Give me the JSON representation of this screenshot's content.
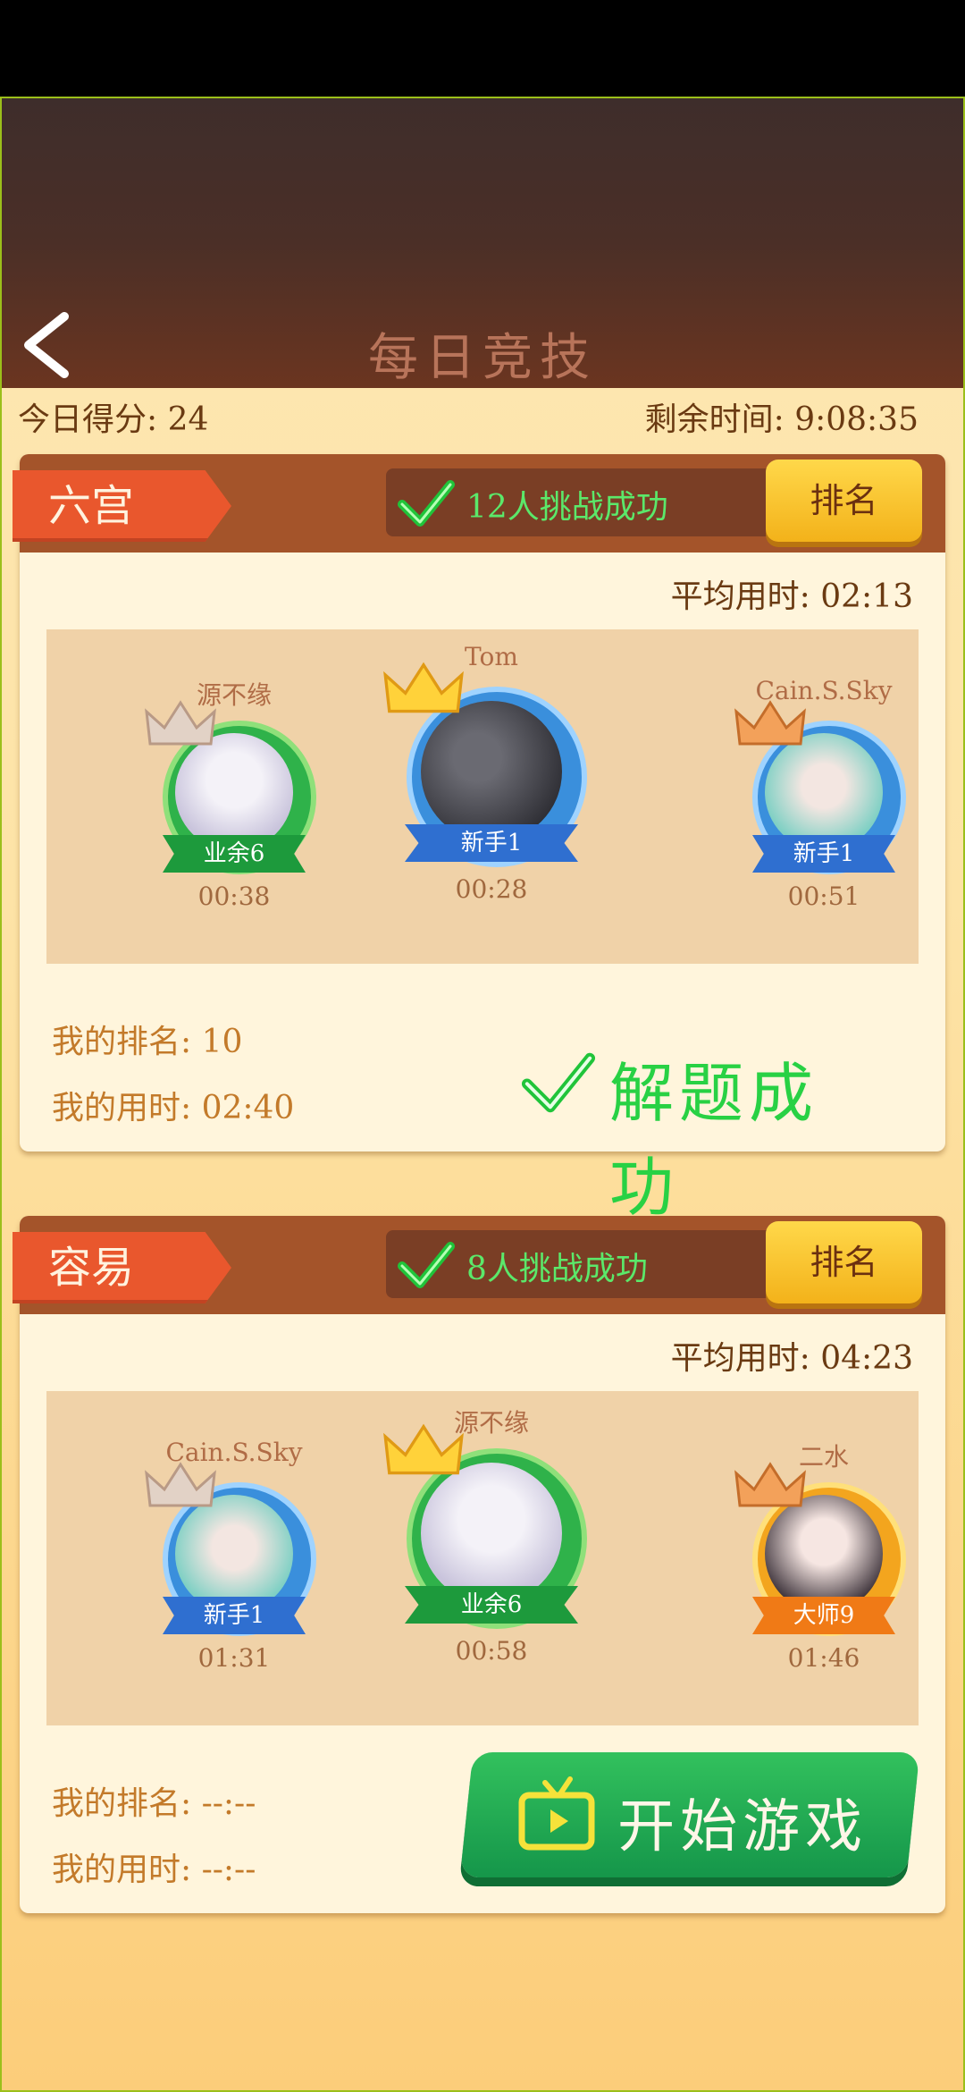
{
  "header": {
    "title": "每日竞技",
    "back_icon": "chevron-left-icon"
  },
  "score": {
    "today_label": "今日得分: 24",
    "remaining_label": "剩余时间: 9:08:35"
  },
  "levels": [
    {
      "difficulty": "六宫",
      "challenge_text": "12人挑战成功",
      "rank_button": "排名",
      "avg_time": "平均用时: 02:13",
      "players": [
        {
          "name": "源不缘",
          "rank": "业余6",
          "time": "00:38",
          "crown": "silver-crown-icon",
          "ring": "#2fb24a"
        },
        {
          "name": "Tom",
          "rank": "新手1",
          "time": "00:28",
          "crown": "gold-crown-icon",
          "ring": "#3a8fdc"
        },
        {
          "name": "Cain.S.Sky",
          "rank": "新手1",
          "time": "00:51",
          "crown": "bronze-crown-icon",
          "ring": "#3a8fdc"
        }
      ],
      "my_rank": "我的排名: 10",
      "my_time": "我的用时: 02:40",
      "status": "解题成功"
    },
    {
      "difficulty": "容易",
      "challenge_text": "8人挑战成功",
      "rank_button": "排名",
      "avg_time": "平均用时: 04:23",
      "players": [
        {
          "name": "Cain.S.Sky",
          "rank": "新手1",
          "time": "01:31",
          "crown": "silver-crown-icon",
          "ring": "#3a8fdc"
        },
        {
          "name": "源不缘",
          "rank": "业余6",
          "time": "00:58",
          "crown": "gold-crown-icon",
          "ring": "#2fb24a"
        },
        {
          "name": "二水",
          "rank": "大师9",
          "time": "01:46",
          "crown": "bronze-crown-icon",
          "ring": "#f3a51e"
        }
      ],
      "my_rank": "我的排名: --:--",
      "my_time": "我的用时: --:--",
      "action": "开始游戏"
    }
  ]
}
